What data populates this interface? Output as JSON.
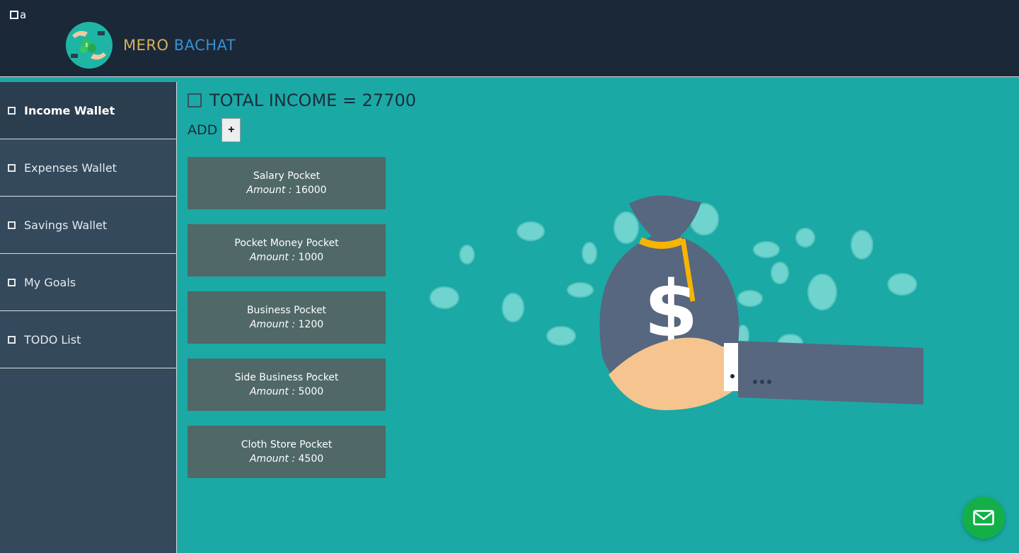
{
  "topbar": {
    "menu_label": "a",
    "brand_part1": "MERO",
    "brand_part2": "BACHAT"
  },
  "sidebar": {
    "items": [
      {
        "label": "Income Wallet",
        "active": true
      },
      {
        "label": "Expenses Wallet",
        "active": false
      },
      {
        "label": "Savings Wallet",
        "active": false
      },
      {
        "label": "My Goals",
        "active": false
      },
      {
        "label": "TODO List",
        "active": false
      }
    ]
  },
  "main": {
    "total_label": "TOTAL INCOME = 27700",
    "add_label": "ADD",
    "add_button": "+",
    "amount_label": "Amount :",
    "pockets": [
      {
        "name": "Salary Pocket",
        "amount": "16000"
      },
      {
        "name": "Pocket Money Pocket",
        "amount": "1000"
      },
      {
        "name": "Business Pocket",
        "amount": "1200"
      },
      {
        "name": "Side Business Pocket",
        "amount": "5000"
      },
      {
        "name": "Cloth Store Pocket",
        "amount": "4500"
      }
    ]
  },
  "icons": {
    "menu": "square-icon",
    "logo": "money-hands-logo-icon",
    "nav": "square-icon",
    "total": "square-icon",
    "fab": "mail-icon"
  },
  "colors": {
    "topbar": "#1b2838",
    "sidebar": "#34495c",
    "main_bg": "#1ba9a6",
    "pocket": "#506868",
    "fab": "#13b04a"
  }
}
